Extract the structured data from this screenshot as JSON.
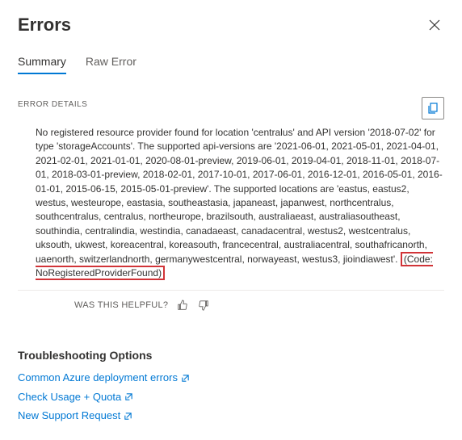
{
  "header": {
    "title": "Errors"
  },
  "tabs": {
    "summary": "Summary",
    "raw": "Raw Error"
  },
  "details": {
    "label": "ERROR DETAILS",
    "message": "No registered resource provider found for location 'centralus' and API version '2018-07-02' for type 'storageAccounts'. The supported api-versions are '2021-06-01, 2021-05-01, 2021-04-01, 2021-02-01, 2021-01-01, 2020-08-01-preview, 2019-06-01, 2019-04-01, 2018-11-01, 2018-07-01, 2018-03-01-preview, 2018-02-01, 2017-10-01, 2017-06-01, 2016-12-01, 2016-05-01, 2016-01-01, 2015-06-15, 2015-05-01-preview'. The supported locations are 'eastus, eastus2, westus, westeurope, eastasia, southeastasia, japaneast, japanwest, northcentralus, southcentralus, centralus, northeurope, brazilsouth, australiaeast, australiasoutheast, southindia, centralindia, westindia, canadaeast, canadacentral, westus2, westcentralus, uksouth, ukwest, koreacentral, koreasouth, francecentral, australiacentral, southafricanorth, uaenorth, switzerlandnorth, germanywestcentral, norwayeast, westus3, jioindiawest'. ",
    "code": "(Code: NoRegisteredProviderFound)"
  },
  "helpful": {
    "label": "WAS THIS HELPFUL?"
  },
  "troubleshooting": {
    "heading": "Troubleshooting Options",
    "links": {
      "common": "Common Azure deployment errors",
      "quota": "Check Usage + Quota",
      "support": "New Support Request"
    }
  }
}
